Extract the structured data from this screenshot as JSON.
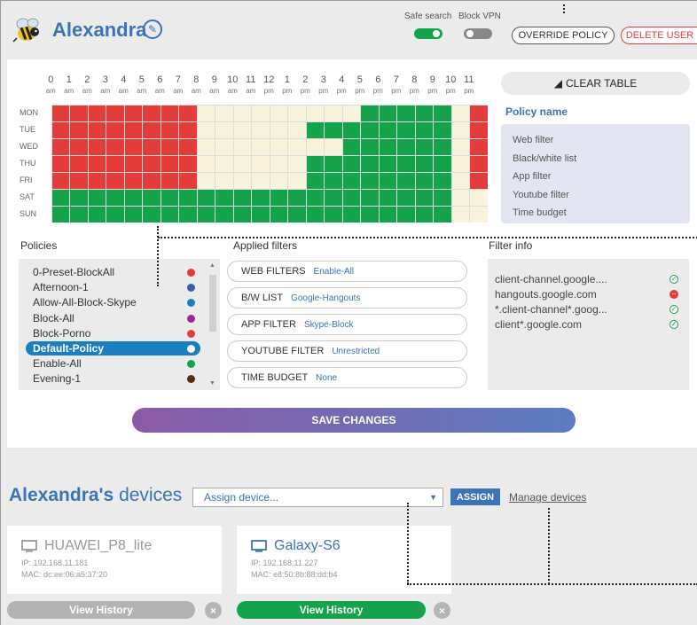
{
  "header": {
    "user_name": "Alexandra",
    "safe_search_label": "Safe search",
    "block_vpn_label": "Block VPN",
    "safe_search_on": true,
    "block_vpn_on": false,
    "override_label": "OVERRIDE POLICY",
    "delete_label": "DELETE USER"
  },
  "schedule": {
    "hours": [
      "0",
      "1",
      "2",
      "3",
      "4",
      "5",
      "6",
      "7",
      "8",
      "9",
      "10",
      "11",
      "12",
      "1",
      "2",
      "3",
      "4",
      "5",
      "6",
      "7",
      "8",
      "9",
      "10",
      "11"
    ],
    "ampm": [
      "am",
      "am",
      "am",
      "am",
      "am",
      "am",
      "am",
      "am",
      "am",
      "am",
      "am",
      "am",
      "pm",
      "pm",
      "pm",
      "pm",
      "pm",
      "pm",
      "pm",
      "pm",
      "pm",
      "pm",
      "pm",
      "pm"
    ],
    "days": [
      "MON",
      "TUE",
      "WED",
      "THU",
      "FRI",
      "SAT",
      "SUN"
    ],
    "colors": {
      "r": "#e53b3b",
      "g": "#14a34a",
      "c": "#faf3dc"
    },
    "rows": [
      "rrrrrrrrcccccccccgggggcr",
      "rrrrrrrrccccccggggggggcr",
      "rrrrrrrrccccccccggggggcr",
      "rrrrrrrrccccccggggggggcr",
      "rrrrrrrrccccccggggggggcr",
      "ggggggggggggggggggggggcc",
      "ggggggggggggggggggggggcc"
    ]
  },
  "clear_table_label": "CLEAR TABLE",
  "policy_name": {
    "title": "Policy name",
    "items": [
      "Web filter",
      "Black/white list",
      "App filter",
      "Youtube filter",
      "Time budget"
    ]
  },
  "policies": {
    "title": "Policies",
    "items": [
      {
        "name": "0-Preset-BlockAll",
        "color": "#e53b3b"
      },
      {
        "name": "Afternoon-1",
        "color": "#3c5aa8"
      },
      {
        "name": "Allow-All-Block-Skype",
        "color": "#1a7fc1"
      },
      {
        "name": "Block-All",
        "color": "#a0269a"
      },
      {
        "name": "Block-Porno",
        "color": "#e53b3b"
      },
      {
        "name": "Default-Policy",
        "color": "#ffffff",
        "selected": true
      },
      {
        "name": "Enable-All",
        "color": "#14a34a"
      },
      {
        "name": "Evening-1",
        "color": "#5b2a12"
      }
    ]
  },
  "applied_filters": {
    "title": "Applied filters",
    "items": [
      {
        "key": "WEB FILTERS",
        "value": "Enable-All"
      },
      {
        "key": "B/W LIST",
        "value": "Google-Hangouts"
      },
      {
        "key": "APP FILTER",
        "value": "Skype-Block"
      },
      {
        "key": "YOUTUBE FILTER",
        "value": "Unrestricted"
      },
      {
        "key": "TIME BUDGET",
        "value": "None"
      }
    ]
  },
  "filter_info": {
    "title": "Filter info",
    "items": [
      {
        "text": "client-channel.google....",
        "status": "allow"
      },
      {
        "text": "hangouts.google.com",
        "status": "block"
      },
      {
        "text": "*.client-channel*.goog...",
        "status": "allow"
      },
      {
        "text": "client*.google.com",
        "status": "allow"
      }
    ]
  },
  "save_label": "SAVE CHANGES",
  "devices": {
    "title_name": "Alexandra's",
    "title_rest": "devices",
    "assign_placeholder": "Assign device...",
    "assign_label": "ASSIGN",
    "manage_label": "Manage devices",
    "cards": [
      {
        "name": "HUAWEI_P8_lite",
        "ip": "IP: 192.168.11.181",
        "mac": "MAC: dc:ee:06:a5:37:20",
        "active": false,
        "history_label": "View History"
      },
      {
        "name": "Galaxy-S6",
        "ip": "IP: 192.168.11.227",
        "mac": "MAC: e8:50:8b:88:dd:b4",
        "active": true,
        "history_label": "View History"
      }
    ]
  }
}
